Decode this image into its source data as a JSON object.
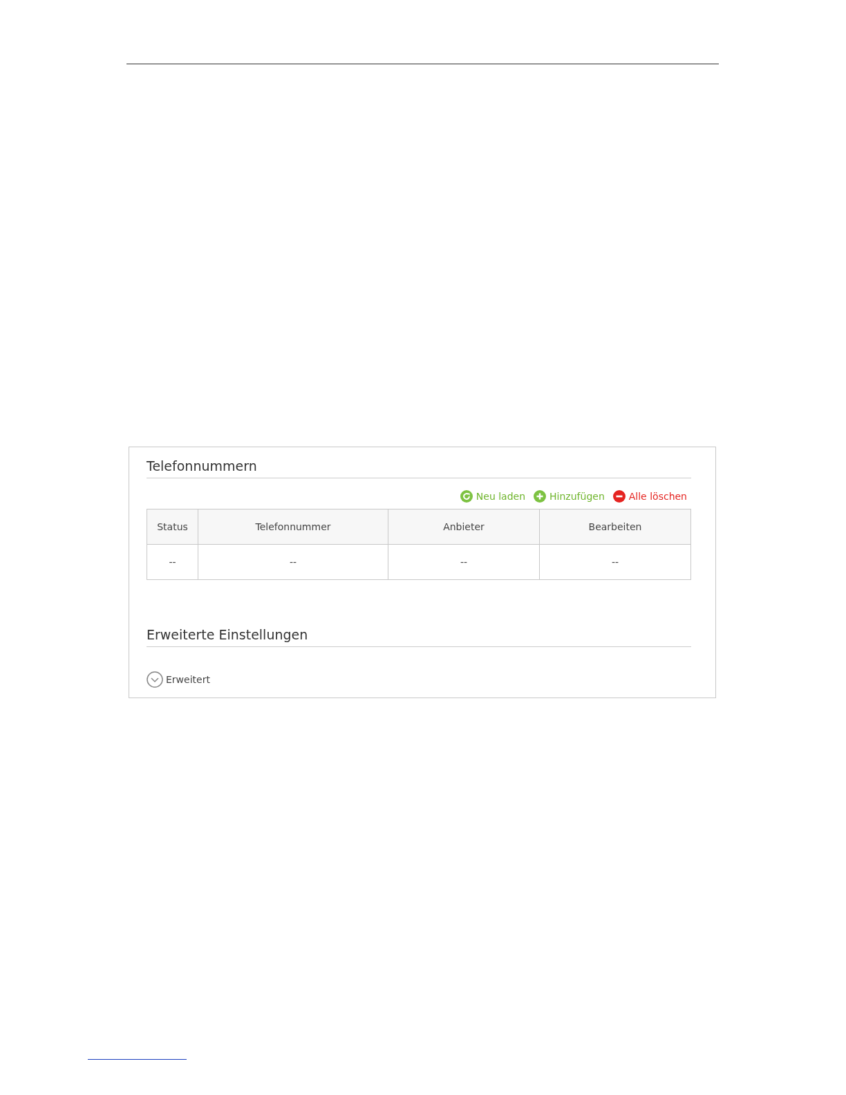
{
  "panel": {
    "title": "Telefonnummern",
    "actions": [
      {
        "kind": "reload",
        "label": "Neu laden"
      },
      {
        "kind": "add",
        "label": "Hinzufügen"
      },
      {
        "kind": "delete",
        "label": "Alle löschen"
      }
    ],
    "table": {
      "columns": [
        "Status",
        "Telefonnummer",
        "Anbieter",
        "Bearbeiten"
      ],
      "rows": [
        [
          "--",
          "--",
          "--",
          "--"
        ]
      ]
    },
    "advanced": {
      "title": "Erweiterte Einstellungen",
      "toggle": {
        "label": "Erweitert",
        "expanded": false
      }
    }
  }
}
